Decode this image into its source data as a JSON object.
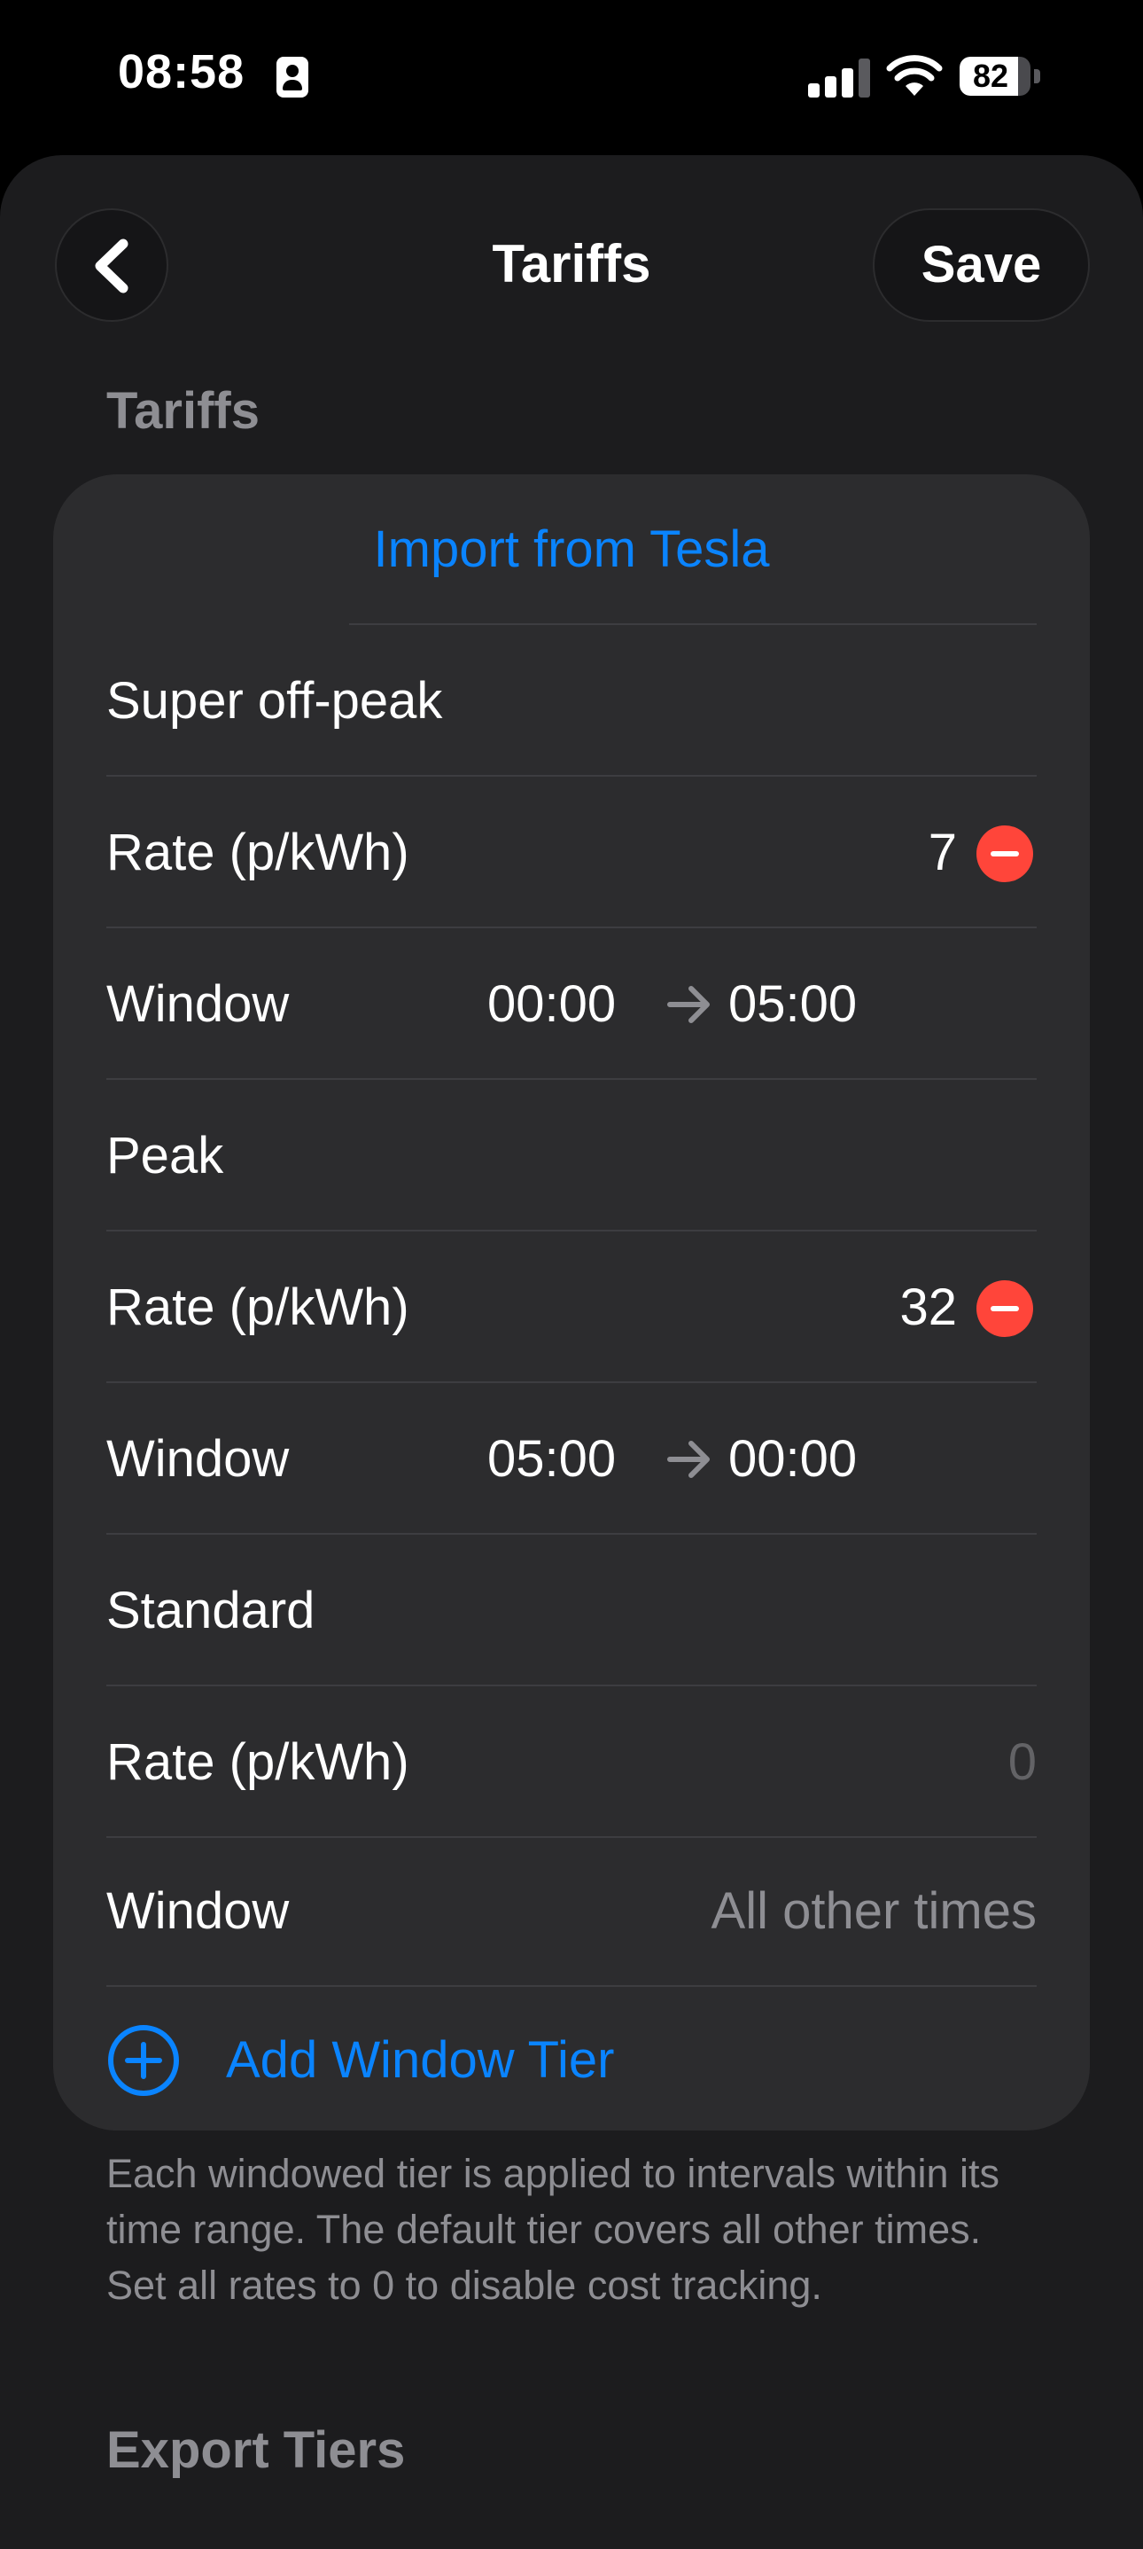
{
  "status_bar": {
    "time": "08:58",
    "battery_percent": "82",
    "battery_level": 0.82,
    "signal_bars_active": 3,
    "signal_bars_total": 4
  },
  "nav": {
    "title": "Tariffs",
    "save_label": "Save",
    "back_icon": "chevron-left-icon"
  },
  "section_title": "Tariffs",
  "import_label": "Import from Tesla",
  "tiers": [
    {
      "name": "Super off-peak",
      "rate_label": "Rate (p/kWh)",
      "rate": "7",
      "window_label": "Window",
      "start": "00:00",
      "end": "05:00",
      "removable": true
    },
    {
      "name": "Peak",
      "rate_label": "Rate (p/kWh)",
      "rate": "32",
      "window_label": "Window",
      "start": "05:00",
      "end": "00:00",
      "removable": true
    }
  ],
  "default_tier": {
    "name": "Standard",
    "rate_label": "Rate (p/kWh)",
    "rate_placeholder": "0",
    "window_label": "Window",
    "window_value": "All other times"
  },
  "add_tier_label": "Add Window Tier",
  "footnote": "Each windowed tier is applied to intervals within its time range. The default tier covers all other times. Set all rates to 0 to disable cost tracking.",
  "export_section_title": "Export Tiers",
  "colors": {
    "accent": "#0a84ff",
    "destructive": "#ff453a",
    "card": "#2c2c2e",
    "background": "#1c1c1e",
    "secondary_text": "#8e8e93"
  }
}
